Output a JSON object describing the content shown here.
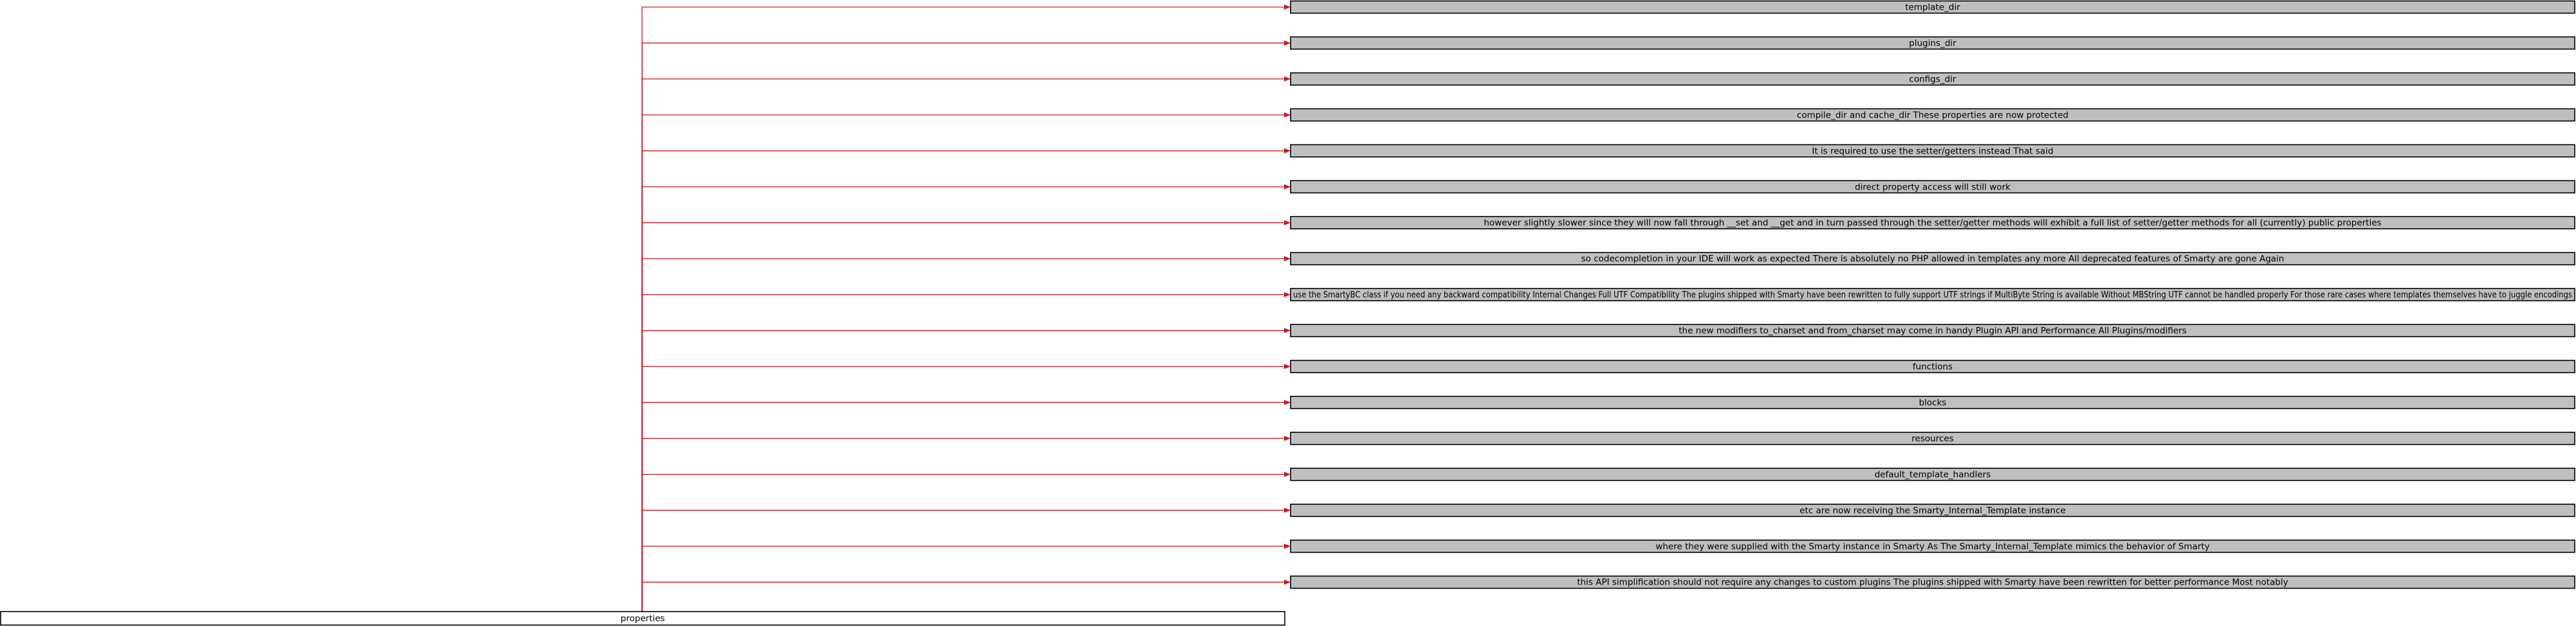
{
  "diagram": {
    "type": "dependency-graph",
    "edge_color": "#c8191f",
    "root": {
      "label": "properties"
    },
    "nodes": [
      {
        "label": "template_dir"
      },
      {
        "label": "plugins_dir"
      },
      {
        "label": "configs_dir"
      },
      {
        "label": "compile_dir and cache_dir These properties are now protected"
      },
      {
        "label": "It is required to use the setter/getters instead That said"
      },
      {
        "label": "direct property access will still work"
      },
      {
        "label": "however slightly slower since they will now fall through __set and __get and in turn passed through the setter/getter methods will exhibit a full list of setter/getter methods for all (currently) public properties"
      },
      {
        "label": "so codecompletion in your IDE will work as expected There is absolutely no PHP allowed in templates any more All deprecated features of Smarty are gone Again"
      },
      {
        "label": "use the SmartyBC class if you need any backward compatibility Internal Changes Full UTF Compatibility The plugins shipped with Smarty have been rewritten to fully support UTF strings if MultiByte String is available Without MBString UTF cannot be handled properly For those rare cases where templates themselves have to juggle encodings"
      },
      {
        "label": "the new modifiers to_charset and from_charset may come in handy Plugin API and Performance All Plugins/modifiers"
      },
      {
        "label": "functions"
      },
      {
        "label": "blocks"
      },
      {
        "label": "resources"
      },
      {
        "label": "default_template_handlers"
      },
      {
        "label": "etc are now receiving the Smarty_Internal_Template instance"
      },
      {
        "label": "where they were supplied with the Smarty instance in Smarty As The Smarty_Internal_Template mimics the behavior of Smarty"
      },
      {
        "label": "this API simplification should not require any changes to custom plugins The plugins shipped with Smarty have been rewritten for better performance Most notably"
      }
    ]
  }
}
